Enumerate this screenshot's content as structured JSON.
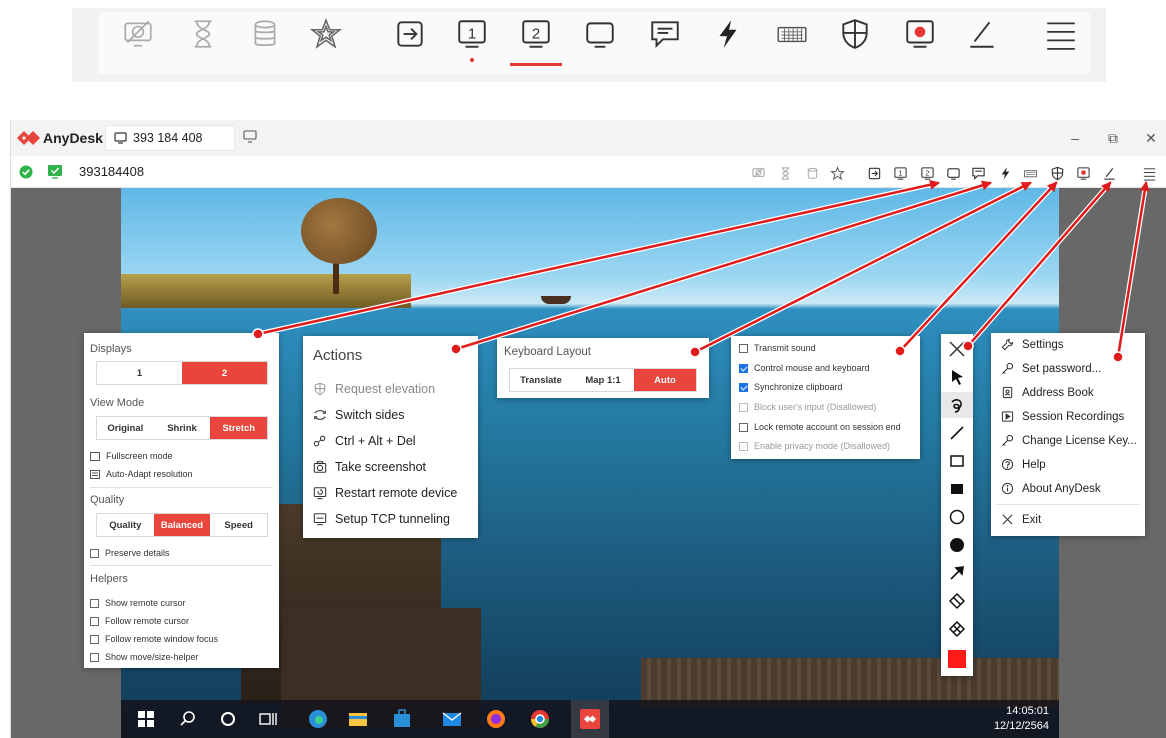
{
  "zoomed_toolbar": {
    "icons": [
      "privacy-monitor-icon",
      "hourglass-icon",
      "database-icon",
      "star-icon",
      "enter-icon",
      "display-1-icon",
      "display-2-icon",
      "monitor-icon",
      "chat-icon",
      "lightning-icon",
      "keyboard-icon",
      "shield-icon",
      "record-icon",
      "pen-icon",
      "menu-icon"
    ],
    "display1_label": "1",
    "display2_label": "2"
  },
  "window": {
    "app_name": "AnyDesk",
    "tab_label": "393 184 408",
    "address": "393184408",
    "controls": {
      "minimize": "–",
      "restore": "⧉",
      "close": "✕"
    }
  },
  "display_panel": {
    "displays_title": "Displays",
    "displays": [
      "1",
      "2"
    ],
    "view_mode_title": "View Mode",
    "view_modes": [
      "Original",
      "Shrink",
      "Stretch"
    ],
    "fullscreen": "Fullscreen mode",
    "auto_adapt": "Auto-Adapt resolution",
    "quality_title": "Quality",
    "qualities": [
      "Quality",
      "Balanced",
      "Speed"
    ],
    "preserve": "Preserve details",
    "helpers_title": "Helpers",
    "helpers": [
      "Show remote cursor",
      "Follow remote cursor",
      "Follow remote window focus",
      "Show move/size-helper"
    ]
  },
  "actions_panel": {
    "title": "Actions",
    "items": [
      "Request elevation",
      "Switch sides",
      "Ctrl + Alt + Del",
      "Take screenshot",
      "Restart remote device",
      "Setup TCP tunneling"
    ]
  },
  "keyboard_panel": {
    "title": "Keyboard Layout",
    "options": [
      "Translate",
      "Map 1:1",
      "Auto"
    ]
  },
  "permissions_panel": {
    "items": [
      "Transmit sound",
      "Control mouse and keyboard",
      "Synchronize clipboard",
      "Block user's input (Disallowed)",
      "Lock remote account on session end",
      "Enable privacy mode (Disallowed)"
    ]
  },
  "main_menu": {
    "items": [
      "Settings",
      "Set password...",
      "Address Book",
      "Session Recordings",
      "Change License Key...",
      "Help",
      "About AnyDesk"
    ],
    "exit": "Exit"
  },
  "taskbar": {
    "time": "14:05:01",
    "date": "12/12/2564"
  },
  "colors": {
    "accent": "#e8453c",
    "arrow": "#e01b1b",
    "check": "#1a73e8"
  }
}
